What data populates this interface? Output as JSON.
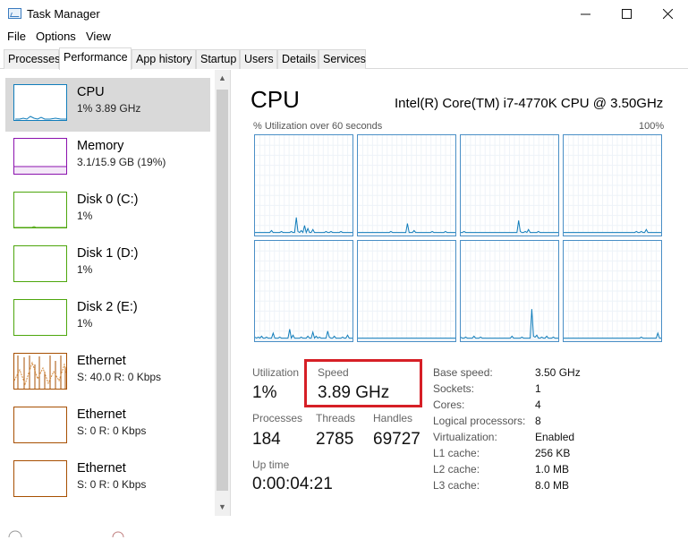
{
  "window": {
    "title": "Task Manager"
  },
  "menu": [
    "File",
    "Options",
    "View"
  ],
  "tabs": [
    "Processes",
    "Performance",
    "App history",
    "Startup",
    "Users",
    "Details",
    "Services"
  ],
  "resources": [
    {
      "name": "CPU",
      "sub": "1% 3.89 GHz",
      "color": "#117dbb"
    },
    {
      "name": "Memory",
      "sub": "3.1/15.9 GB (19%)",
      "color": "#8b12ae"
    },
    {
      "name": "Disk 0 (C:)",
      "sub": "1%",
      "color": "#4da60c"
    },
    {
      "name": "Disk 1 (D:)",
      "sub": "1%",
      "color": "#4da60c"
    },
    {
      "name": "Disk 2 (E:)",
      "sub": "1%",
      "color": "#4da60c"
    },
    {
      "name": "Ethernet",
      "sub": "S: 40.0 R: 0 Kbps",
      "color": "#a74f01"
    },
    {
      "name": "Ethernet",
      "sub": "S: 0 R: 0 Kbps",
      "color": "#a74f01"
    },
    {
      "name": "Ethernet",
      "sub": "S: 0 R: 0 Kbps",
      "color": "#a74f01"
    }
  ],
  "main": {
    "title": "CPU",
    "model": "Intel(R) Core(TM) i7-4770K CPU @ 3.50GHz",
    "util_label": "% Utilization over 60 seconds",
    "util_max": "100%"
  },
  "core_graph_series": [
    [
      3,
      3,
      3,
      3,
      3,
      3,
      3,
      3,
      3,
      3,
      5,
      3,
      3,
      3,
      3,
      3,
      4,
      3,
      3,
      3,
      3,
      3,
      4,
      3,
      3,
      18,
      4,
      3,
      5,
      3,
      10,
      3,
      7,
      3,
      3,
      6,
      3,
      3,
      3,
      3,
      3,
      3,
      3,
      4,
      3,
      3,
      4,
      3,
      3,
      3,
      3,
      3,
      4,
      3,
      3,
      3,
      3,
      3,
      3,
      3
    ],
    [
      3,
      3,
      3,
      3,
      3,
      3,
      3,
      3,
      3,
      3,
      3,
      3,
      3,
      3,
      3,
      3,
      3,
      3,
      3,
      3,
      4,
      3,
      3,
      3,
      3,
      3,
      3,
      3,
      3,
      3,
      12,
      3,
      3,
      3,
      5,
      3,
      3,
      3,
      3,
      3,
      3,
      3,
      3,
      3,
      3,
      4,
      3,
      3,
      3,
      3,
      3,
      3,
      3,
      4,
      3,
      3,
      3,
      3,
      3,
      3
    ],
    [
      3,
      3,
      4,
      3,
      3,
      3,
      3,
      3,
      3,
      3,
      3,
      3,
      3,
      3,
      3,
      3,
      3,
      3,
      3,
      3,
      3,
      3,
      3,
      3,
      3,
      3,
      3,
      3,
      3,
      3,
      3,
      3,
      3,
      3,
      3,
      15,
      4,
      3,
      3,
      4,
      3,
      6,
      3,
      3,
      3,
      3,
      3,
      4,
      3,
      3,
      3,
      3,
      3,
      3,
      3,
      3,
      3,
      3,
      3,
      3
    ],
    [
      3,
      3,
      3,
      3,
      3,
      3,
      3,
      3,
      3,
      3,
      3,
      3,
      3,
      3,
      3,
      3,
      3,
      3,
      3,
      3,
      3,
      3,
      3,
      3,
      3,
      3,
      3,
      3,
      3,
      3,
      3,
      3,
      3,
      3,
      3,
      3,
      3,
      3,
      3,
      3,
      3,
      3,
      3,
      3,
      4,
      3,
      3,
      4,
      3,
      3,
      6,
      3,
      3,
      3,
      3,
      3,
      3,
      3,
      3,
      3
    ],
    [
      4,
      3,
      4,
      3,
      5,
      3,
      3,
      4,
      3,
      3,
      3,
      8,
      3,
      3,
      3,
      4,
      3,
      3,
      3,
      3,
      3,
      12,
      3,
      6,
      3,
      3,
      3,
      3,
      4,
      3,
      3,
      3,
      5,
      3,
      3,
      9,
      3,
      5,
      3,
      4,
      3,
      3,
      3,
      3,
      10,
      4,
      3,
      3,
      5,
      3,
      3,
      3,
      3,
      4,
      3,
      3,
      6,
      3,
      3,
      3
    ],
    [
      3,
      3,
      3,
      3,
      3,
      3,
      3,
      3,
      3,
      3,
      3,
      3,
      3,
      3,
      3,
      3,
      3,
      3,
      3,
      3,
      3,
      3,
      3,
      3,
      3,
      3,
      3,
      3,
      3,
      3,
      3,
      3,
      3,
      3,
      3,
      3,
      3,
      3,
      3,
      3,
      3,
      3,
      3,
      3,
      3,
      3,
      3,
      3,
      3,
      3,
      3,
      3,
      3,
      3,
      3,
      3,
      3,
      3,
      3,
      3
    ],
    [
      4,
      3,
      3,
      4,
      3,
      3,
      3,
      3,
      5,
      3,
      3,
      3,
      4,
      3,
      3,
      3,
      3,
      3,
      3,
      3,
      3,
      3,
      3,
      3,
      3,
      3,
      3,
      3,
      3,
      3,
      3,
      5,
      3,
      3,
      3,
      3,
      3,
      4,
      3,
      3,
      3,
      3,
      3,
      32,
      5,
      4,
      6,
      3,
      3,
      4,
      3,
      3,
      5,
      3,
      3,
      3,
      4,
      3,
      3,
      3
    ],
    [
      3,
      3,
      3,
      3,
      3,
      3,
      3,
      3,
      3,
      3,
      3,
      3,
      3,
      3,
      3,
      3,
      3,
      3,
      3,
      3,
      3,
      3,
      3,
      3,
      3,
      3,
      3,
      3,
      3,
      3,
      3,
      3,
      3,
      3,
      3,
      3,
      3,
      3,
      3,
      3,
      3,
      3,
      3,
      3,
      3,
      3,
      3,
      4,
      3,
      3,
      3,
      3,
      3,
      3,
      3,
      3,
      3,
      8,
      3,
      3
    ]
  ],
  "stats": {
    "utilization": {
      "label": "Utilization",
      "value": "1%"
    },
    "speed": {
      "label": "Speed",
      "value": "3.89 GHz"
    },
    "processes": {
      "label": "Processes",
      "value": "184"
    },
    "threads": {
      "label": "Threads",
      "value": "2785"
    },
    "handles": {
      "label": "Handles",
      "value": "69727"
    },
    "uptime": {
      "label": "Up time",
      "value": "0:00:04:21"
    }
  },
  "specs": [
    {
      "key": "Base speed:",
      "value": "3.50 GHz"
    },
    {
      "key": "Sockets:",
      "value": "1"
    },
    {
      "key": "Cores:",
      "value": "4"
    },
    {
      "key": "Logical processors:",
      "value": "8"
    },
    {
      "key": "Virtualization:",
      "value": "Enabled"
    },
    {
      "key": "L1 cache:",
      "value": "256 KB"
    },
    {
      "key": "L2 cache:",
      "value": "1.0 MB"
    },
    {
      "key": "L3 cache:",
      "value": "8.0 MB"
    }
  ]
}
